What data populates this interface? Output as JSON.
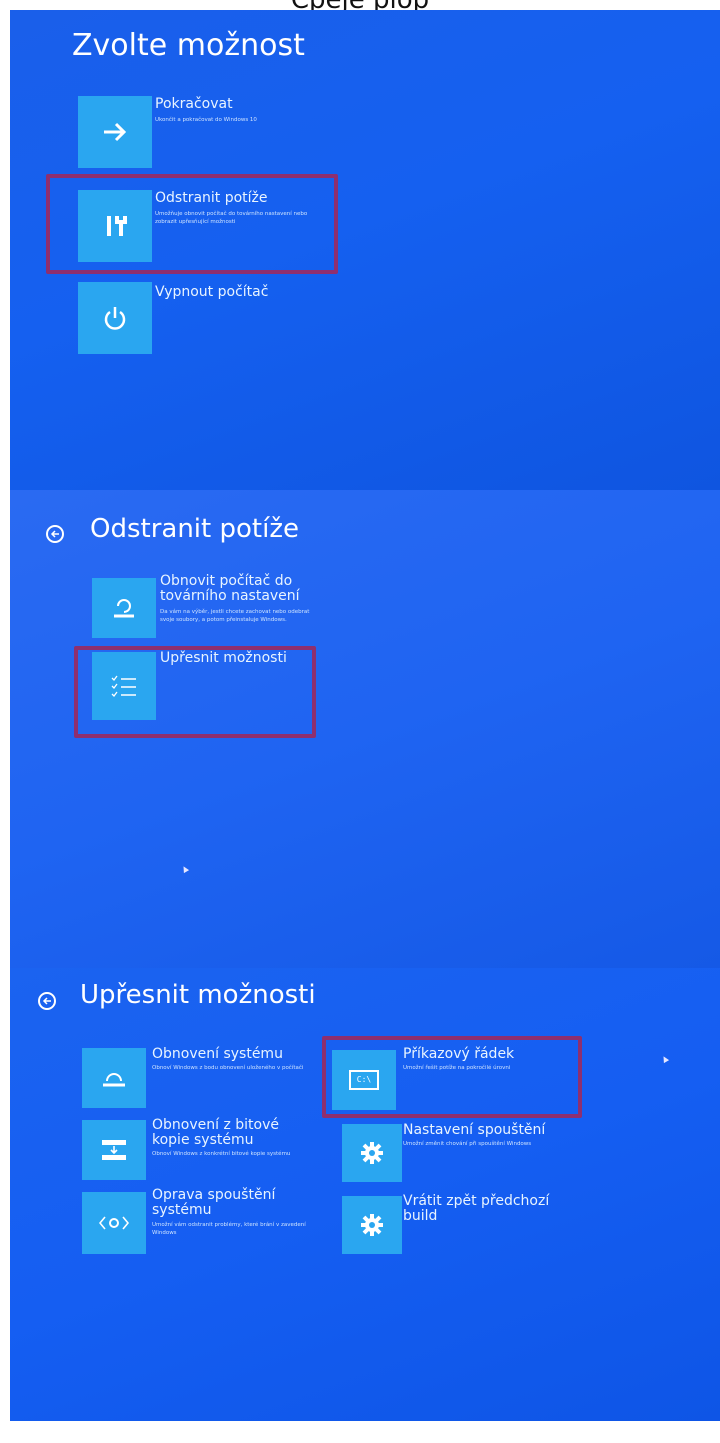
{
  "caption": "Čpeje plop",
  "screen1": {
    "title": "Zvolte možnost",
    "options": [
      {
        "title": "Pokračovat",
        "desc": "Ukončit a pokračovat do Windows 10",
        "icon": "arrow-right-icon"
      },
      {
        "title": "Odstranit potíže",
        "desc": "Umožňuje obnovit počítač do továrního nastavení nebo zobrazit upřesňující možnosti",
        "icon": "tools-icon"
      },
      {
        "title": "Vypnout počítač",
        "desc": "",
        "icon": "power-icon"
      }
    ]
  },
  "screen2": {
    "title": "Odstranit potíže",
    "options": [
      {
        "title": "Obnovit počítač do továrního nastavení",
        "desc": "Da vám na výběr, jestli chcete zachovat nebo odebrat svoje soubory, a potom přeinstaluje Windows.",
        "icon": "reset-icon"
      },
      {
        "title": "Upřesnit možnosti",
        "desc": "",
        "icon": "checklist-icon"
      }
    ]
  },
  "screen3": {
    "title": "Upřesnit možnosti",
    "left": [
      {
        "title": "Obnovení systému",
        "desc": "Obnoví Windows z bodu obnovení uloženého v počítači",
        "icon": "system-restore-icon"
      },
      {
        "title": "Obnovení z bitové kopie systému",
        "desc": "Obnoví Windows z konkrétní bitové kopie systému",
        "icon": "image-recovery-icon"
      },
      {
        "title": "Oprava spouštění systému",
        "desc": "Umožní vám odstranit problémy, které brání v zavedení Windows",
        "icon": "startup-repair-icon"
      }
    ],
    "right": [
      {
        "title": "Příkazový řádek",
        "desc": "Umožní řešit potíže na pokročilé úrovni",
        "icon": "command-prompt-icon",
        "icon_text": "C:\\"
      },
      {
        "title": "Nastavení spouštění",
        "desc": "Umožní změnit chování při spouštění Windows",
        "icon": "gear-icon"
      },
      {
        "title": "Vrátit zpět předchozí build",
        "desc": "",
        "icon": "gear-icon"
      }
    ]
  },
  "colors": {
    "tile": "#2aa6f0",
    "highlight": "#8e2f6f",
    "background": "#1560f0"
  }
}
